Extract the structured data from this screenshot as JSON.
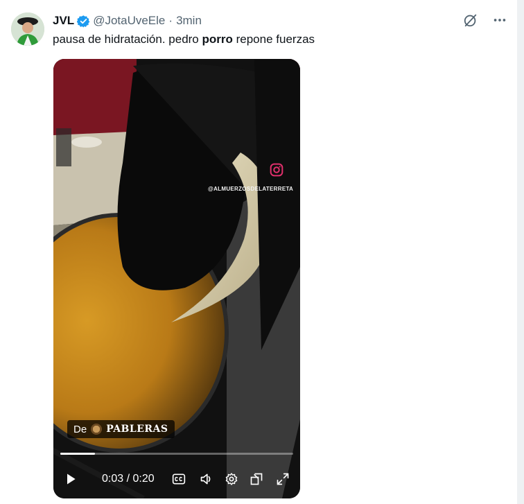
{
  "tweet": {
    "author_name": "JVL",
    "handle": "@JotaUveEle",
    "separator": "·",
    "time": "3min",
    "text_before": "pausa de hidratación. pedro ",
    "text_bold": "porro",
    "text_after": " repone fuerzas"
  },
  "video": {
    "watermark": "@ALMUERZOSDELATERRETA",
    "source_prefix": "De",
    "source_name": "PABLERAS",
    "current_time": "0:03",
    "duration": "0:20",
    "time_display": "0:03 / 0:20",
    "progress_fraction": 0.15
  },
  "colors": {
    "verified": "#1d9bf0",
    "text_primary": "#0f1419",
    "text_secondary": "#536471"
  },
  "icons": {
    "header": [
      "grok-icon",
      "more-icon"
    ],
    "controls": [
      "play-icon",
      "captions-icon",
      "volume-icon",
      "settings-icon",
      "pip-icon",
      "fullscreen-icon"
    ]
  }
}
